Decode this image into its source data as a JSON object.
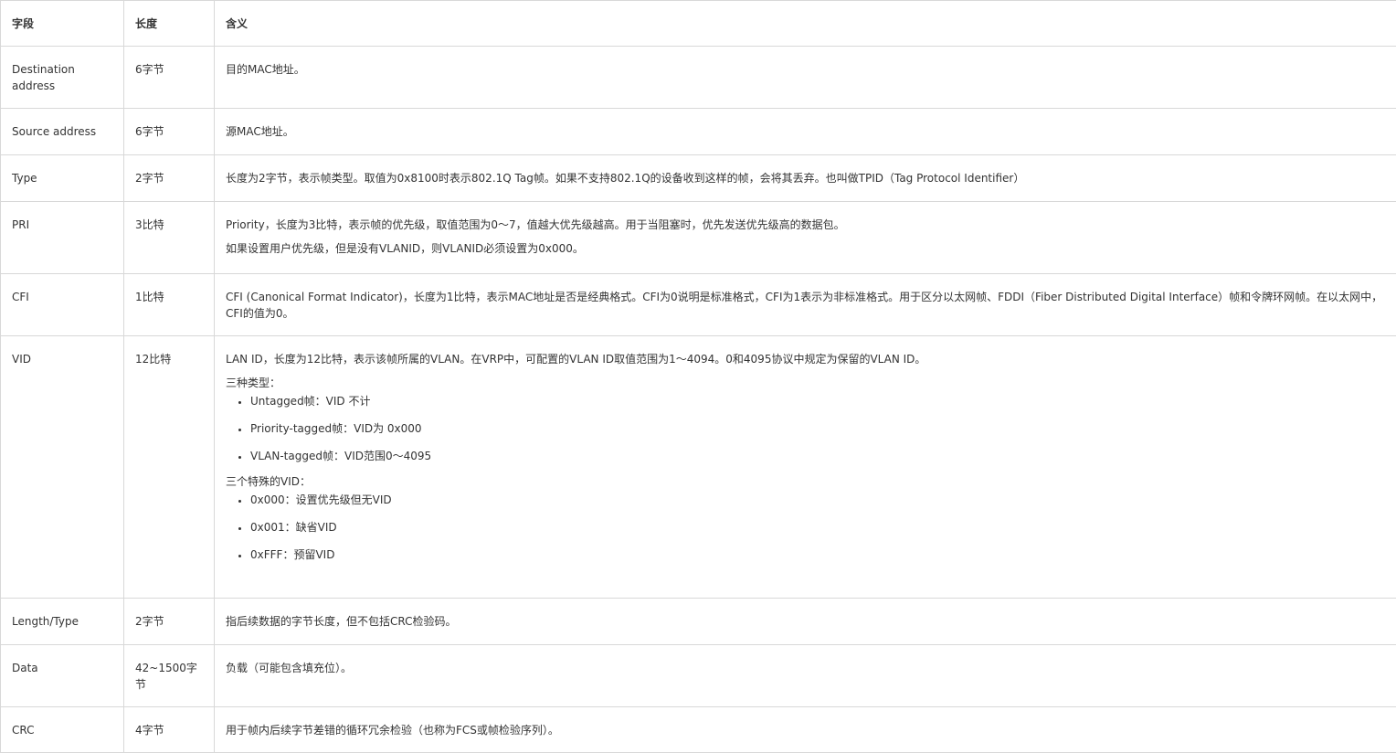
{
  "header": {
    "col1": "字段",
    "col2": "长度",
    "col3": "含义"
  },
  "rows": {
    "dst": {
      "field": "Destination address",
      "len": "6字节",
      "desc": "目的MAC地址。"
    },
    "src": {
      "field": "Source address",
      "len": "6字节",
      "desc": "源MAC地址。"
    },
    "type": {
      "field": "Type",
      "len": "2字节",
      "desc": "长度为2字节，表示帧类型。取值为0x8100时表示802.1Q Tag帧。如果不支持802.1Q的设备收到这样的帧，会将其丢弃。也叫做TPID（Tag Protocol Identifier）"
    },
    "pri": {
      "field": "PRI",
      "len": "3比特",
      "desc": "Priority，长度为3比特，表示帧的优先级，取值范围为0～7，值越大优先级越高。用于当阻塞时，优先发送优先级高的数据包。",
      "note": "如果设置用户优先级，但是没有VLANID，则VLANID必须设置为0x000。"
    },
    "cfi": {
      "field": "CFI",
      "len": "1比特",
      "desc": "CFI (Canonical Format Indicator)，长度为1比特，表示MAC地址是否是经典格式。CFI为0说明是标准格式，CFI为1表示为非标准格式。用于区分以太网帧、FDDI（Fiber Distributed Digital Interface）帧和令牌环网帧。在以太网中，CFI的值为0。"
    },
    "vid": {
      "field": "VID",
      "len": "12比特",
      "desc": "LAN ID，长度为12比特，表示该帧所属的VLAN。在VRP中，可配置的VLAN ID取值范围为1～4094。0和4095协议中规定为保留的VLAN ID。",
      "types_title": "三种类型：",
      "types": [
        "Untagged帧：VID 不计",
        "Priority-tagged帧：VID为 0x000",
        "VLAN-tagged帧：VID范围0～4095"
      ],
      "special_title": "三个特殊的VID：",
      "special": [
        "0x000：设置优先级但无VID",
        "0x001：缺省VID",
        "0xFFF：预留VID"
      ]
    },
    "len": {
      "field": "Length/Type",
      "len": "2字节",
      "desc": "指后续数据的字节长度，但不包括CRC检验码。"
    },
    "data": {
      "field": "Data",
      "len": "42~1500字节",
      "desc": "负载（可能包含填充位）。"
    },
    "crc": {
      "field": "CRC",
      "len": "4字节",
      "desc": "用于帧内后续字节差错的循环冗余检验（也称为FCS或帧检验序列）。"
    }
  }
}
